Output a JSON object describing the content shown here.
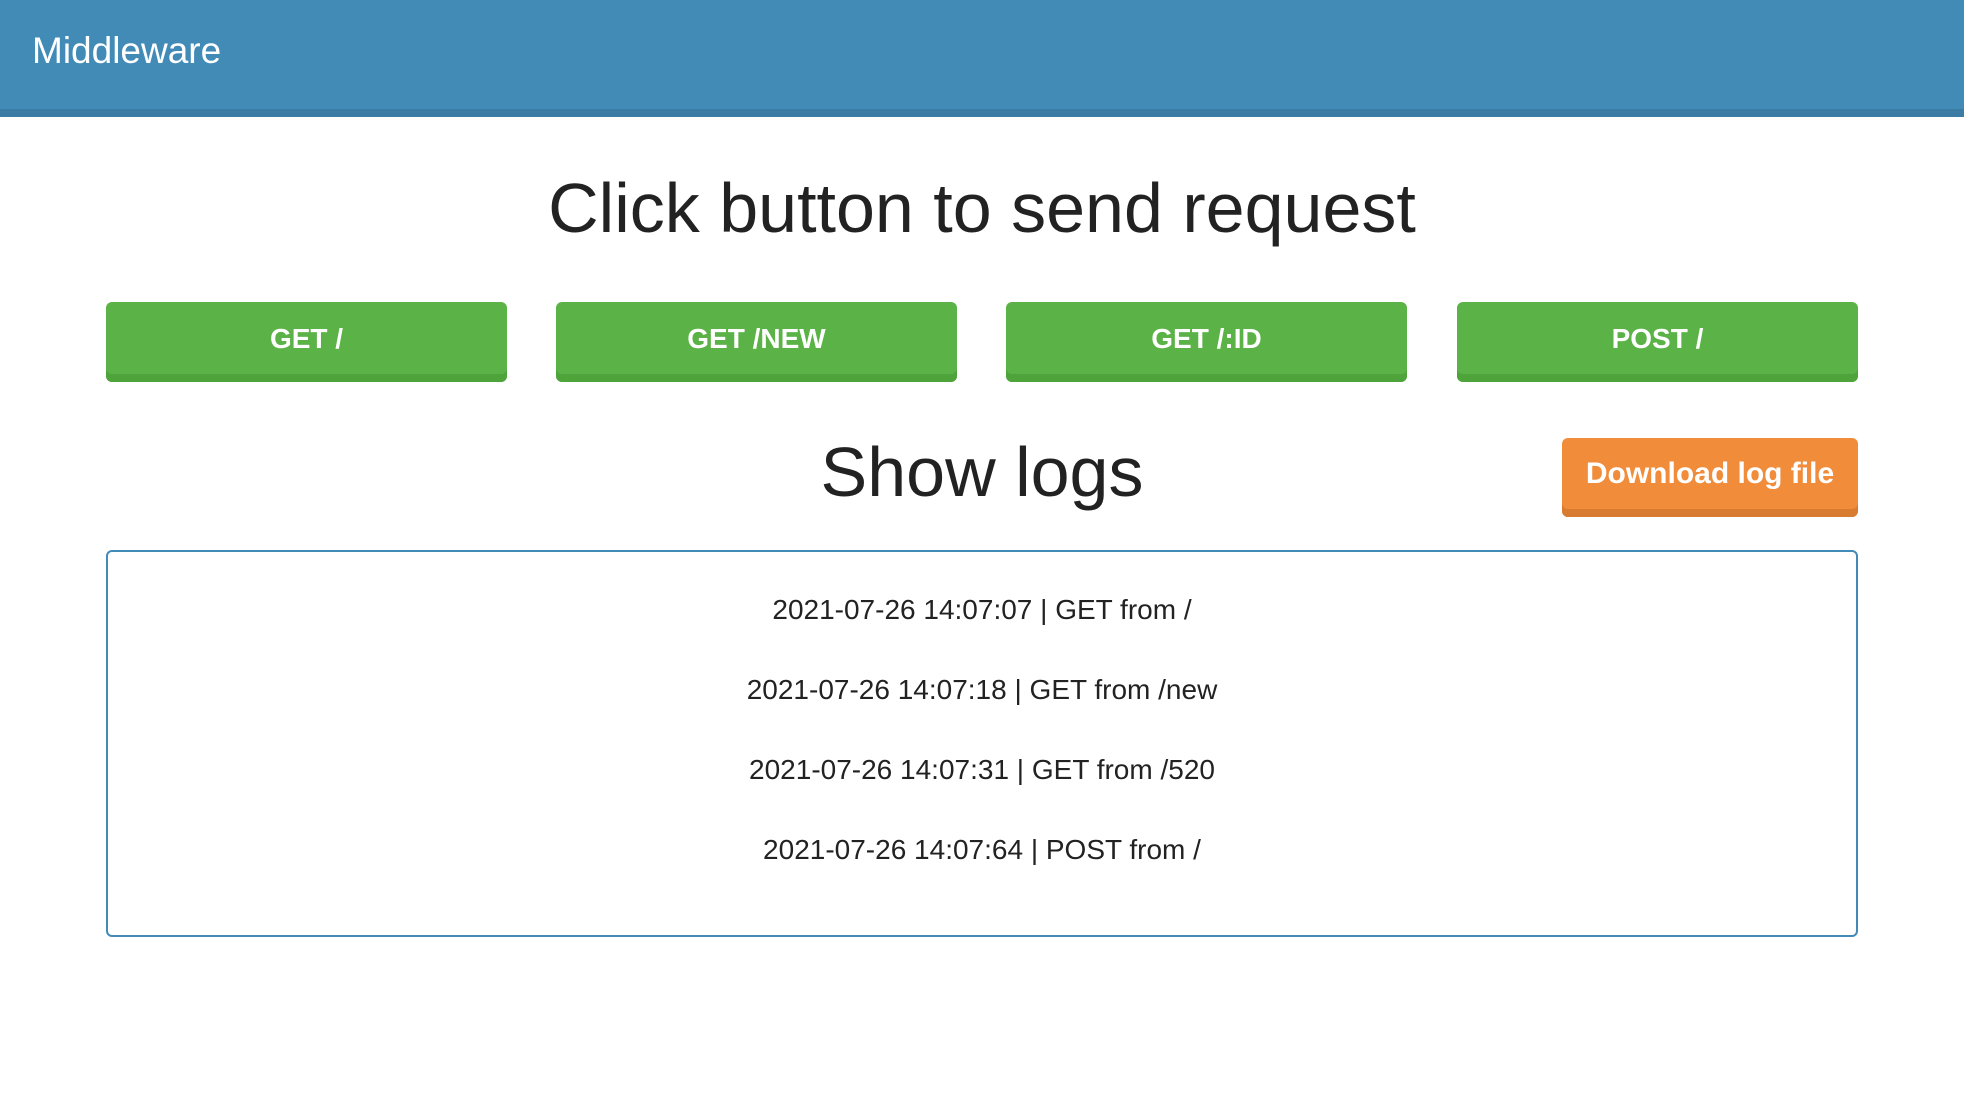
{
  "header": {
    "title": "Middleware"
  },
  "main": {
    "title": "Click button to send request",
    "buttons": [
      {
        "label": "GET /"
      },
      {
        "label": "GET /NEW"
      },
      {
        "label": "GET /:ID"
      },
      {
        "label": "POST /"
      }
    ],
    "logs_title": "Show logs",
    "download_label": "Download log file",
    "logs": [
      "2021-07-26 14:07:07 | GET from /",
      "2021-07-26 14:07:18 | GET from /new",
      "2021-07-26 14:07:31 | GET from /520",
      "2021-07-26 14:07:64 | POST from /"
    ]
  },
  "colors": {
    "header": "#428bb7",
    "green": "#5bb246",
    "orange": "#f08c3a"
  }
}
